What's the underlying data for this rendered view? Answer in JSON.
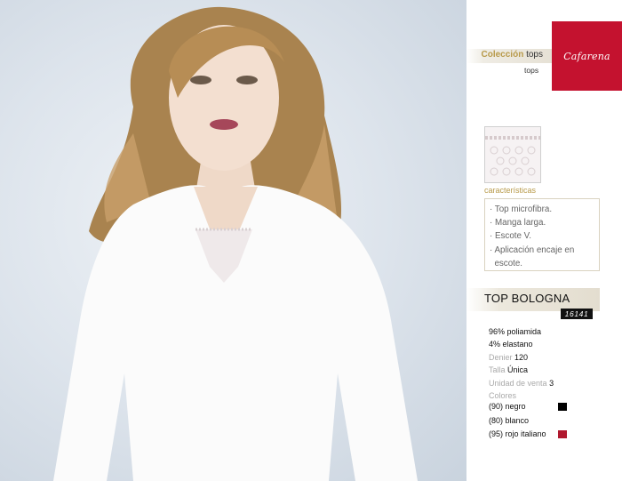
{
  "brand": {
    "logo_text": "Cafarena",
    "color": "#c4122f"
  },
  "collection": {
    "label_gold": "Colección",
    "label_dark": "tops",
    "sub": "tops"
  },
  "features": {
    "title": "características",
    "items": [
      "· Top microfibra.",
      "· Manga larga.",
      "· Escote V.",
      "· Aplicación encaje en",
      "  escote."
    ]
  },
  "product": {
    "name": "TOP BOLOGNA",
    "ref": "16141"
  },
  "specs": {
    "composition_1": "96% poliamida",
    "composition_2": "4% elastano",
    "denier_label": "Denier",
    "denier_value": "120",
    "talla_label": "Talla",
    "talla_value": "Única",
    "unidad_label": "Unidad de venta",
    "unidad_value": "3",
    "colores_label": "Colores"
  },
  "colors": [
    {
      "label": "(90) negro",
      "hex": "#000000"
    },
    {
      "label": "(80) blanco",
      "hex": "#ffffff"
    },
    {
      "label": "(95) rojo italiano",
      "hex": "#b0182e"
    }
  ]
}
